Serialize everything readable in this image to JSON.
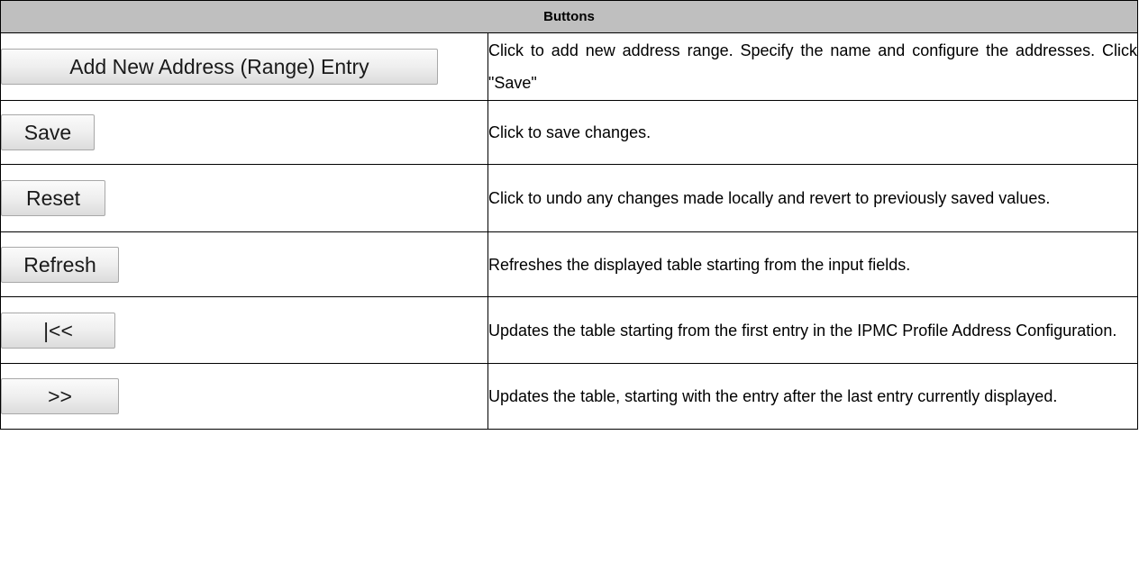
{
  "table": {
    "header": "Buttons",
    "rows": [
      {
        "button_label": "Add New Address (Range) Entry",
        "description": "Click to add new address range. Specify the name and configure the addresses. Click \"Save\""
      },
      {
        "button_label": "Save",
        "description": "Click to save changes."
      },
      {
        "button_label": "Reset",
        "description": "Click to undo any changes made locally and revert to previously saved values."
      },
      {
        "button_label": "Refresh",
        "description": "Refreshes the displayed table starting from the input fields."
      },
      {
        "button_label": "|<<",
        "description": "Updates the table starting from the first entry in the IPMC Profile Address Configuration."
      },
      {
        "button_label": ">>",
        "description": "Updates the table, starting with the entry after the last entry currently displayed."
      }
    ]
  },
  "colors": {
    "header_bg": "#bfbfbf",
    "border": "#000000",
    "button_bg": "#efefef"
  }
}
